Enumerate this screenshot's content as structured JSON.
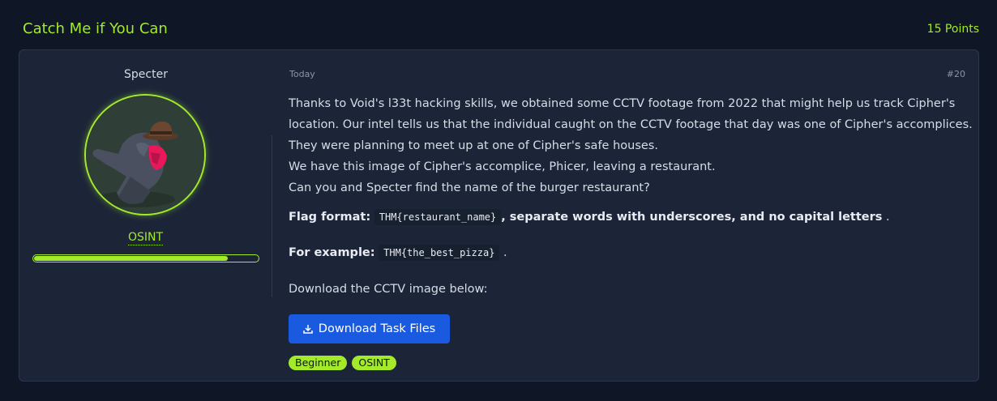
{
  "task": {
    "title": "Catch Me if You Can",
    "points": "15 Points"
  },
  "author": {
    "name": "Specter",
    "category": "OSINT",
    "progress": 0.86
  },
  "post": {
    "date": "Today",
    "number": "#20",
    "lines": [
      "Thanks to Void's l33t hacking skills, we obtained some CCTV footage from 2022 that might help us track Cipher's",
      "location. Our intel tells us that the individual caught on the CCTV footage that day was one of Cipher's accomplices.",
      "They were planning to meet up at one of Cipher's safe houses.",
      "We have this image of Cipher's accomplice, Phicer, leaving a restaurant.",
      "Can you and Specter find the name of the burger restaurant?"
    ],
    "flag_label": "Flag format:",
    "flag_code": "THM{restaurant_name}",
    "flag_rule": ", separate words with underscores, and no capital letters",
    "flag_end": ".",
    "example_label": "For example:",
    "example_code": "THM{the_best_pizza}",
    "example_end": ".",
    "download_text": "Download the CCTV image below:",
    "download_button": "Download Task Files",
    "tags": [
      "Beginner",
      "OSINT"
    ]
  },
  "colors": {
    "accent": "#a3ea2a",
    "background": "#0f1625",
    "card": "#1c2538",
    "button": "#1a5ae0"
  }
}
